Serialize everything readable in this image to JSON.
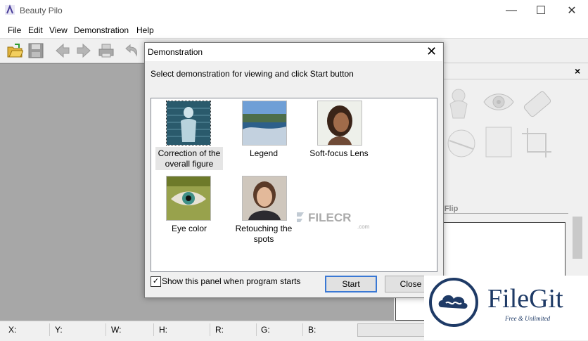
{
  "app": {
    "title": "Beauty Pilo",
    "close_glyph": "✕",
    "maximize_glyph": "☐",
    "minimize_glyph": "—"
  },
  "menu": [
    "File",
    "Edit",
    "View",
    "Demonstration",
    "Help"
  ],
  "toolbar": {
    "icons": [
      "open-folder-icon",
      "save-icon",
      "back-arrow-icon",
      "forward-arrow-icon",
      "print-icon",
      "undo-icon"
    ]
  },
  "right_panel": {
    "close_glyph": "×",
    "section_label": "d Flip"
  },
  "status": {
    "x": "X:",
    "y": "Y:",
    "w": "W:",
    "h": "H:",
    "r": "R:",
    "g": "G:",
    "b": "B:"
  },
  "dialog": {
    "title": "Demonstration",
    "close_glyph": "✕",
    "instruction": "Select demonstration for viewing and click Start button",
    "items": [
      {
        "label1": "Correction of the",
        "label2": "overall figure",
        "selected": true
      },
      {
        "label1": "Legend",
        "label2": ""
      },
      {
        "label1": "Soft-focus Lens",
        "label2": ""
      },
      {
        "label1": "Eye color",
        "label2": ""
      },
      {
        "label1": "Retouching the",
        "label2": "spots"
      }
    ],
    "checkbox_label": "Show this panel when program starts",
    "checkbox_checked": true,
    "check_glyph": "✓",
    "start_label": "Start",
    "close_label": "Close"
  },
  "watermarks": {
    "filecr": "FILECR",
    "filecr_suffix": ".com",
    "filegit": "FileGit",
    "filegit_tagline": "Free & Unlimited"
  }
}
